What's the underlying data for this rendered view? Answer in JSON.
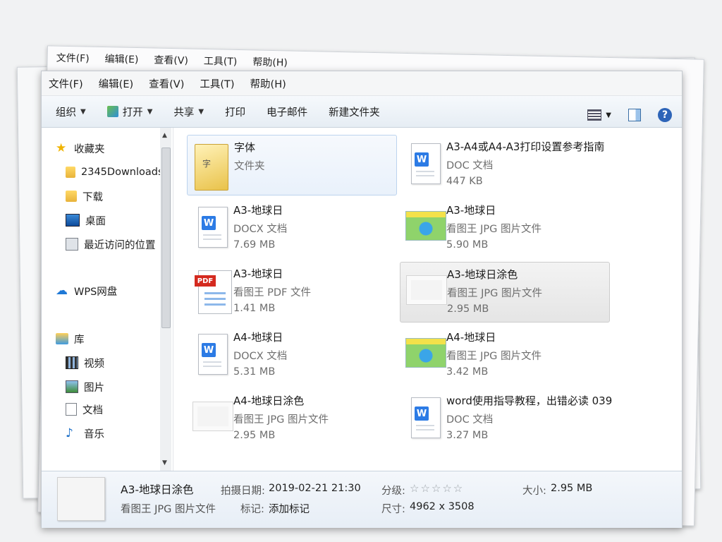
{
  "background_window": {
    "menu": [
      "文件(F)",
      "编辑(E)",
      "查看(V)",
      "工具(T)",
      "帮助(H)"
    ]
  },
  "menubar": [
    "文件(F)",
    "编辑(E)",
    "查看(V)",
    "工具(T)",
    "帮助(H)"
  ],
  "toolbar": {
    "organize": "组织",
    "open": "打开",
    "share": "共享",
    "print": "打印",
    "email": "电子邮件",
    "new_folder": "新建文件夹"
  },
  "sidebar": {
    "favorites": "收藏夹",
    "downloads_folder": "2345Downloads",
    "downloads": "下载",
    "desktop": "桌面",
    "recent": "最近访问的位置",
    "wps": "WPS网盘",
    "libraries": "库",
    "videos": "视频",
    "pictures": "图片",
    "documents": "文档",
    "music": "音乐"
  },
  "files": [
    {
      "name": "字体",
      "type": "文件夹",
      "size": "",
      "icon": "folder-icon"
    },
    {
      "name": "A3-A4或A4-A3打印设置参考指南",
      "type": "DOC 文档",
      "size": "447 KB",
      "icon": "word-icon"
    },
    {
      "name": "A3-地球日",
      "type": "DOCX 文档",
      "size": "7.69 MB",
      "icon": "word-icon"
    },
    {
      "name": "A3-地球日",
      "type": "看图王 JPG 图片文件",
      "size": "5.90 MB",
      "icon": "jpg-thumbnail"
    },
    {
      "name": "A3-地球日",
      "type": "看图王 PDF 文件",
      "size": "1.41 MB",
      "icon": "pdf-icon"
    },
    {
      "name": "A3-地球日涂色",
      "type": "看图王 JPG 图片文件",
      "size": "2.95 MB",
      "icon": "jpg-thumbnail"
    },
    {
      "name": "A4-地球日",
      "type": "DOCX 文档",
      "size": "5.31 MB",
      "icon": "word-icon"
    },
    {
      "name": "A4-地球日",
      "type": "看图王 JPG 图片文件",
      "size": "3.42 MB",
      "icon": "jpg-thumbnail"
    },
    {
      "name": "A4-地球日涂色",
      "type": "看图王 JPG 图片文件",
      "size": "2.95 MB",
      "icon": "jpg-thumbnail"
    },
    {
      "name": "word使用指导教程，出错必读 039",
      "type": "DOC 文档",
      "size": "3.27 MB",
      "icon": "word-icon"
    }
  ],
  "details": {
    "name": "A3-地球日涂色",
    "type": "看图王 JPG 图片文件",
    "date_label": "拍摄日期:",
    "date_value": "2019-02-21 21:30",
    "tag_label": "标记:",
    "tag_value": "添加标记",
    "rating_label": "分级:",
    "rating_stars": "☆☆☆☆☆",
    "dimensions_label": "尺寸:",
    "dimensions_value": "4962 x 3508",
    "size_label": "大小:",
    "size_value": "2.95 MB"
  }
}
